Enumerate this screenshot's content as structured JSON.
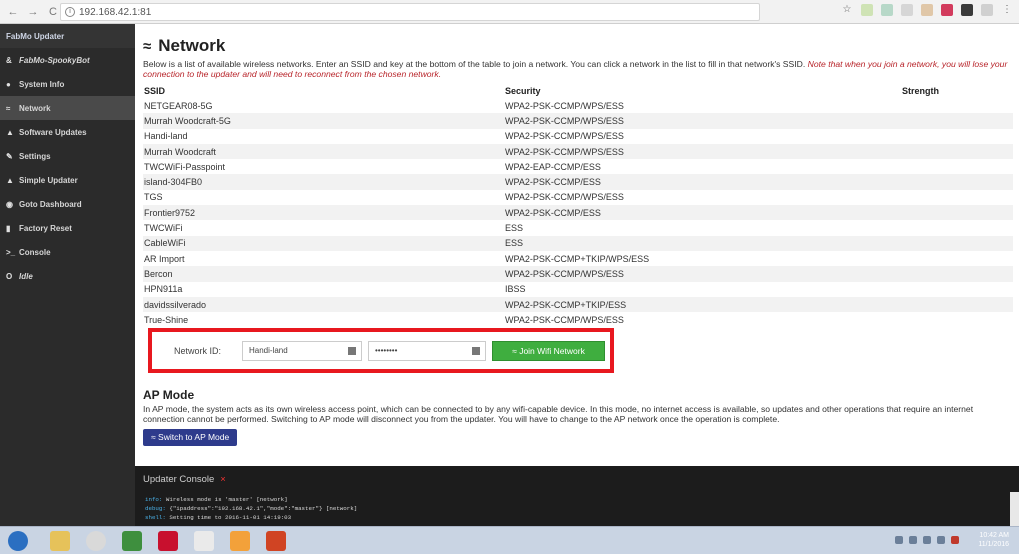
{
  "browser": {
    "url": "192.168.42.1:81",
    "back_glyph": "←",
    "forward_glyph": "→",
    "reload_glyph": "C",
    "info_glyph": "i",
    "star_glyph": "☆",
    "menu_glyph": "⋮"
  },
  "sidebar": {
    "header": "FabMo Updater",
    "items": [
      {
        "icon": "&",
        "label": "FabMo-SpookyBot",
        "active": false,
        "italic": true
      },
      {
        "icon": "●",
        "label": "System Info",
        "active": false,
        "italic": false
      },
      {
        "icon": "≈",
        "label": "Network",
        "active": true,
        "italic": false
      },
      {
        "icon": "▲",
        "label": "Software Updates",
        "active": false,
        "italic": false
      },
      {
        "icon": "✎",
        "label": "Settings",
        "active": false,
        "italic": false
      },
      {
        "icon": "▲",
        "label": "Simple Updater",
        "active": false,
        "italic": false
      },
      {
        "icon": "◉",
        "label": "Goto Dashboard",
        "active": false,
        "italic": false
      },
      {
        "icon": "▮",
        "label": "Factory Reset",
        "active": false,
        "italic": false
      },
      {
        "icon": ">_",
        "label": "Console",
        "active": false,
        "italic": false
      },
      {
        "icon": "O",
        "label": "Idle",
        "active": false,
        "italic": true
      }
    ]
  },
  "network": {
    "title": "Network",
    "desc": "Below is a list of available wireless networks. Enter an SSID and key at the bottom of the table to join a network. You can click a network in the list to fill in that network's SSID.",
    "note": "Note that when you join a network, you will lose your connection to the updater and will need to reconnect from the chosen network.",
    "columns": {
      "ssid": "SSID",
      "security": "Security",
      "strength": "Strength"
    },
    "rows": [
      {
        "ssid": "NETGEAR08-5G",
        "security": "WPA2-PSK-CCMP/WPS/ESS"
      },
      {
        "ssid": "Murrah Woodcraft-5G",
        "security": "WPA2-PSK-CCMP/WPS/ESS"
      },
      {
        "ssid": "Handi-land",
        "security": "WPA2-PSK-CCMP/WPS/ESS"
      },
      {
        "ssid": "Murrah Woodcraft",
        "security": "WPA2-PSK-CCMP/WPS/ESS"
      },
      {
        "ssid": "TWCWiFi-Passpoint",
        "security": "WPA2-EAP-CCMP/ESS"
      },
      {
        "ssid": "island-304FB0",
        "security": "WPA2-PSK-CCMP/ESS"
      },
      {
        "ssid": "TGS",
        "security": "WPA2-PSK-CCMP/WPS/ESS"
      },
      {
        "ssid": "Frontier9752",
        "security": "WPA2-PSK-CCMP/ESS"
      },
      {
        "ssid": "TWCWiFi",
        "security": "ESS"
      },
      {
        "ssid": "CableWiFi",
        "security": "ESS"
      },
      {
        "ssid": "AR Import",
        "security": "WPA2-PSK-CCMP+TKIP/WPS/ESS"
      },
      {
        "ssid": "Bercon",
        "security": "WPA2-PSK-CCMP/WPS/ESS"
      },
      {
        "ssid": "HPN911a",
        "security": "IBSS"
      },
      {
        "ssid": "davidssilverado",
        "security": "WPA2-PSK-CCMP+TKIP/ESS"
      },
      {
        "ssid": "True-Shine",
        "security": "WPA2-PSK-CCMP/WPS/ESS"
      }
    ]
  },
  "join": {
    "label": "Network ID:",
    "ssid_value": "Handi-land",
    "key_value": "••••••••",
    "button": "Join Wifi Network"
  },
  "ap": {
    "title": "AP Mode",
    "text": "In AP mode, the system acts as its own wireless access point, which can be connected to by any wifi-capable device. In this mode, no internet access is available, so updates and other operations that require an internet connection cannot be performed. Switching to AP mode will disconnect you from the updater. You will have to change to the AP network once the operation is complete.",
    "button": "Switch to AP Mode"
  },
  "console": {
    "title": "Updater Console",
    "close": "×",
    "lines": [
      {
        "level": "info:",
        "text": " Wireless mode is 'master' [network]"
      },
      {
        "level": "debug:",
        "text": " {\"ipaddress\":\"192.168.42.1\",\"mode\":\"master\"} [network]"
      },
      {
        "level": "shell:",
        "text": " Setting time to 2016-11-01 14:19:03"
      }
    ]
  },
  "taskbar": {
    "time": "10:42 AM",
    "date": "11/1/2016"
  }
}
